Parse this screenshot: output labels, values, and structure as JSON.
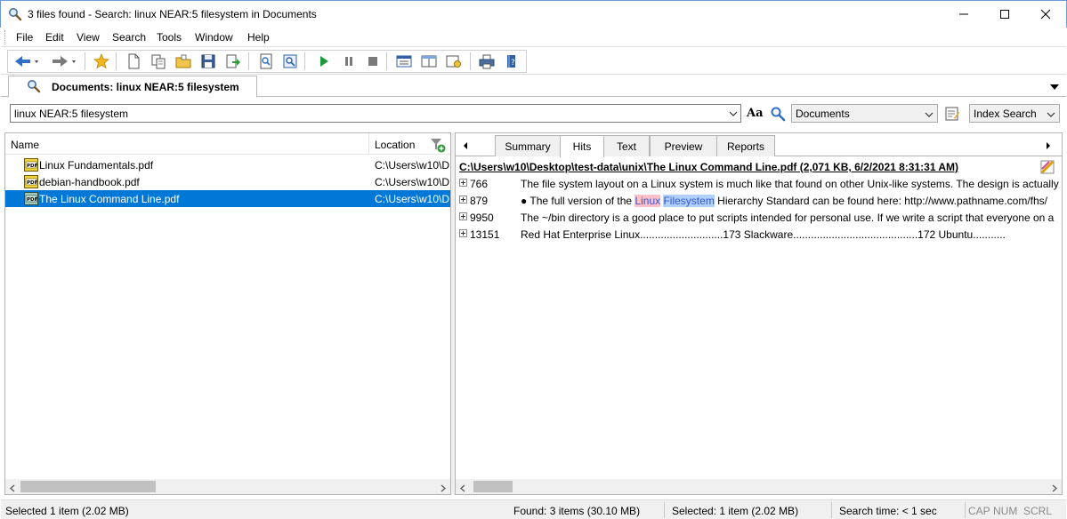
{
  "window": {
    "title": "3 files found - Search: linux NEAR:5 filesystem in Documents"
  },
  "menu": [
    "File",
    "Edit",
    "View",
    "Search",
    "Tools",
    "Window",
    "Help"
  ],
  "toolbar": {
    "icons": [
      "back-arrow-icon",
      "forward-arrow-icon",
      "favorites-star-icon",
      "new-document-icon",
      "copy-document-icon",
      "open-folder-icon",
      "save-icon",
      "export-icon",
      "index-icon",
      "search-index-icon",
      "play-icon",
      "pause-icon",
      "stop-icon",
      "layout-icon",
      "preview-pane-icon",
      "options-icon",
      "print-icon",
      "help-icon"
    ]
  },
  "doc_tab": {
    "label": "Documents: linux NEAR:5 filesystem"
  },
  "search": {
    "query": "linux NEAR:5 filesystem",
    "aa_label": "Aa",
    "scope": "Documents",
    "mode": "Index Search"
  },
  "results": {
    "columns": {
      "name": "Name",
      "location": "Location"
    },
    "rows": [
      {
        "name": "Linux Fundamentals.pdf",
        "location": "C:\\Users\\w10\\D"
      },
      {
        "name": "debian-handbook.pdf",
        "location": "C:\\Users\\w10\\D"
      },
      {
        "name": "The Linux Command Line.pdf",
        "location": "C:\\Users\\w10\\D"
      }
    ],
    "selected_index": 2
  },
  "detail_tabs": [
    "Summary",
    "Hits",
    "Text",
    "Preview",
    "Reports"
  ],
  "active_detail_tab": "Hits",
  "hits": {
    "header": "C:\\Users\\w10\\Desktop\\test-data\\unix\\The Linux Command Line.pdf  (2,071 KB,  6/2/2021 8:31:31 AM)",
    "rows": [
      {
        "num": "766",
        "text": "The file system layout on a Linux system is much like that found on other Unix-like systems. The design is actually"
      },
      {
        "num": "879",
        "pre": "● The full version of the ",
        "hl1": "Linux",
        "mid": " ",
        "hl2": "Filesystem",
        "post": " Hierarchy Standard can be found here: http://www.pathname.com/fhs/"
      },
      {
        "num": "9950",
        "text": "The ~/bin directory is a good place to put scripts intended for personal use. If we write a script that everyone on a"
      },
      {
        "num": "13151",
        "text": "Red Hat Enterprise Linux............................173 Slackware..........................................172 Ubuntu..........."
      }
    ]
  },
  "status": {
    "selected_left": "Selected 1 item (2.02 MB)",
    "found": "Found: 3 items (30.10 MB)",
    "selected_right": "Selected: 1 item (2.02 MB)",
    "search_time": "Search time: < 1 sec",
    "cap": "CAP",
    "num": "NUM",
    "scrl": "SCRL"
  },
  "colors": {
    "selection": "#0078d7",
    "highlight_linux": "#ffc0cb",
    "highlight_filesystem": "#b0d0ff"
  }
}
